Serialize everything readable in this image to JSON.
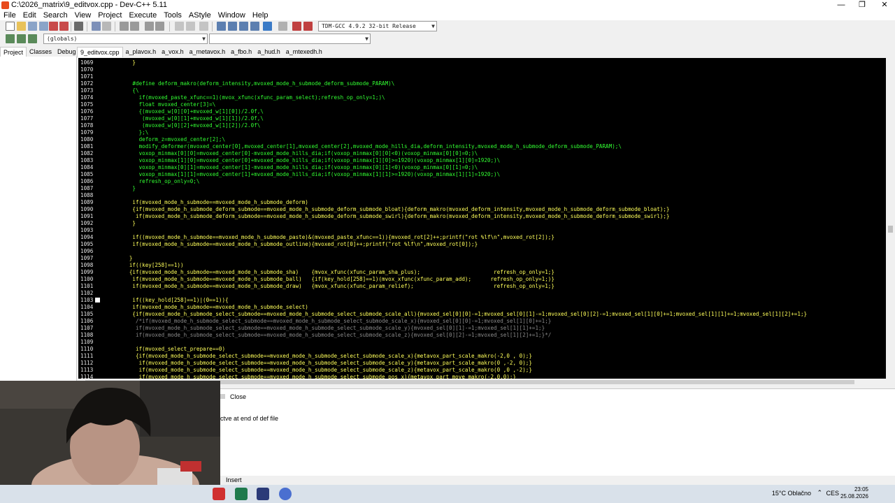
{
  "window": {
    "title": "C:\\2026_matrix\\9_editvox.cpp - Dev-C++ 5.11",
    "minimize": "—",
    "maximize": "❐",
    "close": "✕"
  },
  "menu": [
    "File",
    "Edit",
    "Search",
    "View",
    "Project",
    "Execute",
    "Tools",
    "AStyle",
    "Window",
    "Help"
  ],
  "toolbar": {
    "compiler": "TDM-GCC 4.9.2 32-bit Release",
    "scope": "(globals)"
  },
  "left_tabs": [
    "Project",
    "Classes",
    "Debug"
  ],
  "editor_tabs": [
    "9_editvox.cpp",
    "a_plavox.h",
    "a_vox.h",
    "a_metavox.h",
    "a_fbo.h",
    "a_hud.h",
    "a_mtexedh.h"
  ],
  "code_lines": [
    {
      "n": "1069",
      "t": "      }",
      "c": "c-yellow"
    },
    {
      "n": "1070",
      "t": "",
      "c": "c-green"
    },
    {
      "n": "1071",
      "t": "",
      "c": "c-green"
    },
    {
      "n": "1072",
      "t": "      #define deform_makro(deform_intensity,mvoxed_mode_h_submode_deform_submode_PARAM)\\",
      "c": "c-green"
    },
    {
      "n": "1073",
      "t": "      {\\",
      "c": "c-green"
    },
    {
      "n": "1074",
      "t": "        if(mvoxed_paste_xfunc==1)(mvox_xfunc(xfunc_param_select);refresh_op_only=1;)\\",
      "c": "c-green"
    },
    {
      "n": "1075",
      "t": "        float mvoxed_center[3]=\\",
      "c": "c-green"
    },
    {
      "n": "1076",
      "t": "        {(mvoxed_w[0][0]+mvoxed_w[1][0])/2.0f,\\",
      "c": "c-green"
    },
    {
      "n": "1077",
      "t": "         (mvoxed_w[0][1]+mvoxed_w[1][1])/2.0f,\\",
      "c": "c-green"
    },
    {
      "n": "1078",
      "t": "         (mvoxed_w[0][2]+mvoxed_w[1][2])/2.0f\\",
      "c": "c-green"
    },
    {
      "n": "1079",
      "t": "        };\\",
      "c": "c-green"
    },
    {
      "n": "1080",
      "t": "        deform_z=mvoxed_center[2];\\",
      "c": "c-green"
    },
    {
      "n": "1081",
      "t": "        modify_deformer(mvoxed_center[0],mvoxed_center[1],mvoxed_center[2],mvoxed_mode_hills_dia,deform_intensity,mvoxed_mode_h_submode_deform_submode_PARAM);\\",
      "c": "c-green"
    },
    {
      "n": "1082",
      "t": "        voxop_minmax[0][0]=mvoxed_center[0]-mvoxed_mode_hills_dia;if(voxop_minmax[0][0]<0)(voxop_minmax[0][0]=0;)\\",
      "c": "c-green"
    },
    {
      "n": "1083",
      "t": "        voxop_minmax[1][0]=mvoxed_center[0]+mvoxed_mode_hills_dia;if(voxop_minmax[1][0]>=1920)(voxop_minmax[1][0]=1920;)\\",
      "c": "c-green"
    },
    {
      "n": "1084",
      "t": "        voxop_minmax[0][1]=mvoxed_center[1]-mvoxed_mode_hills_dia;if(voxop_minmax[0][1]<0)(voxop_minmax[0][1]=0;)\\",
      "c": "c-green"
    },
    {
      "n": "1085",
      "t": "        voxop_minmax[1][1]=mvoxed_center[1]+mvoxed_mode_hills_dia;if(voxop_minmax[1][1]>=1920)(voxop_minmax[1][1]=1920;)\\",
      "c": "c-green"
    },
    {
      "n": "1086",
      "t": "        refresh_op_only=0;\\",
      "c": "c-green"
    },
    {
      "n": "1087",
      "t": "      }",
      "c": "c-green"
    },
    {
      "n": "1088",
      "t": "",
      "c": "c-yellow"
    },
    {
      "n": "1089",
      "t": "      if(mvoxed_mode_h_submode==mvoxed_mode_h_submode_deform)",
      "c": "c-yellow"
    },
    {
      "n": "1090",
      "t": "      {if(mvoxed_mode_h_submode_deform_submode==mvoxed_mode_h_submode_deform_submode_bloat){deform_makro(mvoxed_deform_intensity,mvoxed_mode_h_submode_deform_submode_bloat);}",
      "c": "c-yellow"
    },
    {
      "n": "1091",
      "t": "       if(mvoxed_mode_h_submode_deform_submode==mvoxed_mode_h_submode_deform_submode_swirl){deform_makro(mvoxed_deform_intensity,mvoxed_mode_h_submode_deform_submode_swirl);}",
      "c": "c-yellow"
    },
    {
      "n": "1092",
      "t": "      }",
      "c": "c-yellow"
    },
    {
      "n": "1093",
      "t": "",
      "c": "c-yellow"
    },
    {
      "n": "1094",
      "t": "      if((mvoxed_mode_h_submode==mvoxed_mode_h_submode_paste)&(mvoxed_paste_xfunc==1)){mvoxed_rot[2]++;printf(\"rot %lf\\n\",mvoxed_rot[2]);}",
      "c": "c-yellow"
    },
    {
      "n": "1095",
      "t": "      if(mvoxed_mode_h_submode==mvoxed_mode_h_submode_outline){mvoxed_rot[0]++;printf(\"rot %lf\\n\",mvoxed_rot[0]);}",
      "c": "c-yellow"
    },
    {
      "n": "1096",
      "t": "",
      "c": "c-yellow"
    },
    {
      "n": "1097",
      "t": "     }",
      "c": "c-yellow"
    },
    {
      "n": "1098",
      "t": "     if((key[258]==1))",
      "c": "c-yellow"
    },
    {
      "n": "1099",
      "t": "     {if(mvoxed_mode_h_submode==mvoxed_mode_h_submode_sha)    {mvox_xfunc(xfunc_param_sha_plus);                       refresh_op_only=1;}",
      "c": "c-yellow"
    },
    {
      "n": "1100",
      "t": "      if(mvoxed_mode_h_submode==mvoxed_mode_h_submode_ball)   {if(key_hold[258]==1)(mvox_xfunc(xfunc_param_add);      refresh_op_only=1;)}",
      "c": "c-yellow"
    },
    {
      "n": "1101",
      "t": "      if(mvoxed_mode_h_submode==mvoxed_mode_h_submode_draw)   {mvox_xfunc(xfunc_param_relief);                         refresh_op_only=1;}",
      "c": "c-yellow"
    },
    {
      "n": "1102",
      "t": "",
      "c": "c-yellow"
    },
    {
      "n": "1103",
      "t": "      if((key_hold[258]==1)|(0==1)){",
      "c": "c-yellow"
    },
    {
      "n": "1104",
      "t": "      if(mvoxed_mode_h_submode==mvoxed_mode_h_submode_select)",
      "c": "c-yellow"
    },
    {
      "n": "1105",
      "t": "      {if(mvoxed_mode_h_submode_select_submode==mvoxed_mode_h_submode_select_submode_scale_all){mvoxed_sel[0][0]-=1;mvoxed_sel[0][1]-=1;mvoxed_sel[0][2]-=1;mvoxed_sel[1][0]+=1;mvoxed_sel[1][1]+=1;mvoxed_sel[1][2]+=1;}",
      "c": "c-yellow"
    },
    {
      "n": "1106",
      "t": "       /*if(mvoxed_mode_h_submode_select_submode==mvoxed_mode_h_submode_select_submode_scale_x){mvoxed_sel[0][0]-=1;mvoxed_sel[1][0]+=1;}",
      "c": "c-gray"
    },
    {
      "n": "1107",
      "t": "       if(mvoxed_mode_h_submode_select_submode==mvoxed_mode_h_submode_select_submode_scale_y){mvoxed_sel[0][1]-=1;mvoxed_sel[1][1]+=1;}",
      "c": "c-gray"
    },
    {
      "n": "1108",
      "t": "       if(mvoxed_mode_h_submode_select_submode==mvoxed_mode_h_submode_select_submode_scale_z){mvoxed_sel[0][2]-=1;mvoxed_sel[1][2]+=1;}*/",
      "c": "c-gray"
    },
    {
      "n": "1109",
      "t": "",
      "c": "c-yellow"
    },
    {
      "n": "1110",
      "t": "       if(mvoxed_select_prepare==0)",
      "c": "c-yellow"
    },
    {
      "n": "1111",
      "t": "       {if(mvoxed_mode_h_submode_select_submode==mvoxed_mode_h_submode_select_submode_scale_x){metavox_part_scale_makro(-2,0 , 0);}",
      "c": "c-yellow"
    },
    {
      "n": "1112",
      "t": "        if(mvoxed_mode_h_submode_select_submode==mvoxed_mode_h_submode_select_submode_scale_y){metavox_part_scale_makro(0 ,-2, 0);}",
      "c": "c-yellow"
    },
    {
      "n": "1113",
      "t": "        if(mvoxed_mode_h_submode_select_submode==mvoxed_mode_h_submode_select_submode_scale_z){metavox_part_scale_makro(0 ,0 ,-2);}",
      "c": "c-yellow"
    },
    {
      "n": "1114",
      "t": "        if(mvoxed_mode_h_submode_select_submode==mvoxed_mode_h_submode_select_submode_pos_x){metavox_part_move_makro(-2,0,0);}",
      "c": "c-yellow"
    }
  ],
  "bottom_panel": {
    "close_label": "Close",
    "log_text": "ctve at end of def file"
  },
  "statusbar": {
    "mode": "Insert"
  },
  "taskbar": {
    "weather": "15°C Oblačno",
    "lang": "CES",
    "time": "23:05",
    "date": "25.08.2026"
  },
  "colors": {
    "editor_bg": "#000000",
    "macro_green": "#32ff32",
    "code_yellow": "#ffff5a",
    "comment_gray": "#8a8a8a"
  }
}
